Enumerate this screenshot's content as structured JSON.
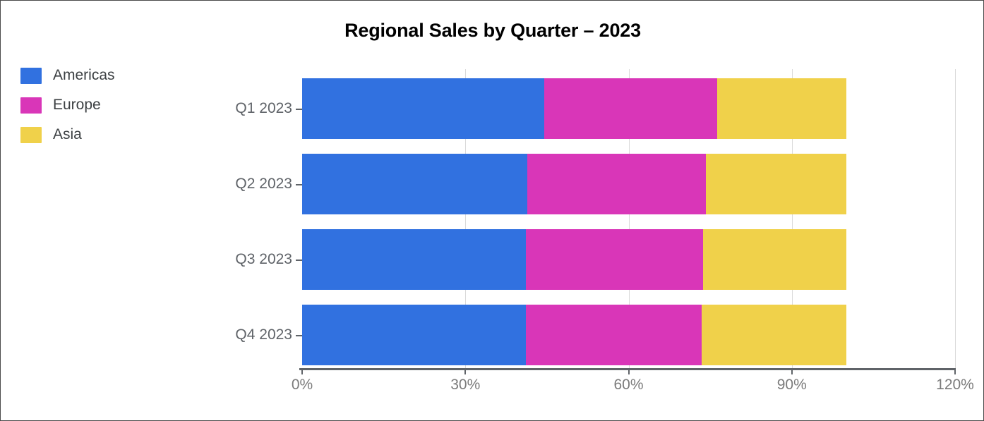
{
  "chart_data": {
    "type": "bar",
    "orientation": "horizontal",
    "stacked": true,
    "title": "Regional Sales by Quarter – 2023",
    "xlabel": "",
    "ylabel": "",
    "categories": [
      "Q1 2023",
      "Q2 2023",
      "Q3 2023",
      "Q4 2023"
    ],
    "series": [
      {
        "name": "Americas",
        "color": "#3171e0",
        "values": [
          44.5,
          41.4,
          41.1,
          41.1
        ]
      },
      {
        "name": "Europe",
        "color": "#d936b8",
        "values": [
          31.8,
          32.8,
          32.6,
          32.3
        ]
      },
      {
        "name": "Asia",
        "color": "#f0d14a",
        "values": [
          23.7,
          25.8,
          26.3,
          26.6
        ]
      }
    ],
    "totals": [
      100,
      100,
      100,
      100
    ],
    "xlim": [
      0,
      120
    ],
    "x_ticks": [
      0,
      30,
      60,
      90,
      120
    ],
    "x_tick_labels": [
      "0%",
      "30%",
      "60%",
      "90%",
      "120%"
    ],
    "grid": "vertical",
    "legend_position": "top-left",
    "value_unit": "%"
  },
  "legend": {
    "items": [
      {
        "label": "Americas",
        "color": "#3171e0"
      },
      {
        "label": "Europe",
        "color": "#d936b8"
      },
      {
        "label": "Asia",
        "color": "#f0d14a"
      }
    ]
  },
  "colors": {
    "americas": "#3171e0",
    "europe": "#d936b8",
    "asia": "#f0d14a",
    "axis": "#5f6368",
    "grid": "#d9d9d9",
    "title": "#000000",
    "tick_label": "#7b7b7b",
    "category_label": "#5f6368",
    "background": "#ffffff",
    "border": "#4a4a4a"
  }
}
